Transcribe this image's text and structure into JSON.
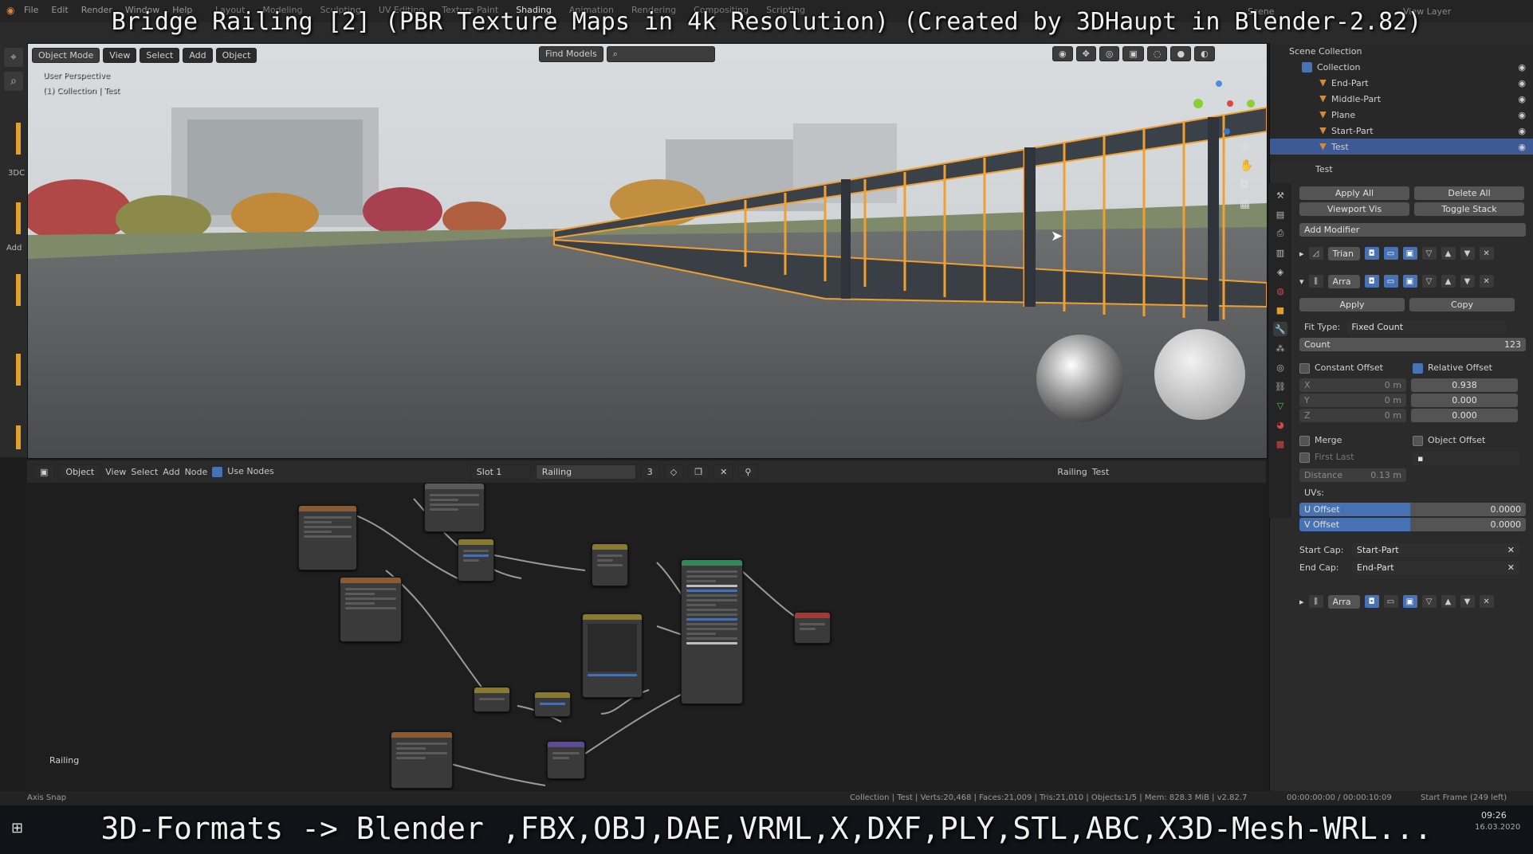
{
  "overlay": {
    "title": "Bridge Railing [2] (PBR Texture Maps in 4k Resolution) (Created by 3DHaupt in Blender-2.82)",
    "bottom": "3D-Formats -> Blender ,FBX,OBJ,DAE,VRML,X,DXF,PLY,STL,ABC,X3D-Mesh-WRL..."
  },
  "topbar": {
    "menus": [
      "File",
      "Edit",
      "Render",
      "Window",
      "Help"
    ],
    "workspaces": [
      "Layout",
      "Modeling",
      "Sculpting",
      "UV Editing",
      "Texture Paint",
      "Shading",
      "Animation",
      "Rendering",
      "Compositing",
      "Scripting"
    ],
    "active_workspace": "Shading",
    "scene": "Scene",
    "view_layer": "View Layer"
  },
  "viewport": {
    "mode": "Object Mode",
    "menus": [
      "View",
      "Select",
      "Add",
      "Object"
    ],
    "find_models": "Find Models",
    "perspective_label": "User Perspective",
    "collection_label": "(1) Collection | Test"
  },
  "left_strip": {
    "label_3d": "3DC",
    "label_add": "Add"
  },
  "node_editor": {
    "type": "Object",
    "menus": [
      "View",
      "Select",
      "Add",
      "Node"
    ],
    "use_nodes": "Use Nodes",
    "slot": "Slot 1",
    "material": "Railing",
    "users": "3",
    "material_right": "Railing",
    "object_right": "Test",
    "frame_label": "Railing"
  },
  "outliner": {
    "root": "Scene Collection",
    "collection": "Collection",
    "items": [
      "End-Part",
      "Middle-Part",
      "Plane",
      "Start-Part",
      "Test"
    ],
    "selected": "Test"
  },
  "properties": {
    "object_name": "Test",
    "apply_all": "Apply All",
    "delete_all": "Delete All",
    "viewport_vis": "Viewport Vis",
    "toggle_stack": "Toggle Stack",
    "add_modifier": "Add Modifier",
    "modifier1": "Trian",
    "modifier2": "Arra",
    "apply": "Apply",
    "copy": "Copy",
    "fit_type_label": "Fit Type:",
    "fit_type": "Fixed Count",
    "count_label": "Count",
    "count": "123",
    "constant_offset": "Constant Offset",
    "relative_offset": "Relative Offset",
    "x_label": "X",
    "y_label": "Y",
    "z_label": "Z",
    "const_x": "0 m",
    "const_y": "0 m",
    "const_z": "0 m",
    "rel_x": "0.938",
    "rel_y": "0.000",
    "rel_z": "0.000",
    "merge": "Merge",
    "object_offset": "Object Offset",
    "first_last": "First Last",
    "distance_label": "Distance",
    "distance": "0.13 m",
    "uvs": "UVs:",
    "u_offset_label": "U Offset",
    "u_offset": "0.0000",
    "v_offset_label": "V Offset",
    "v_offset": "0.0000",
    "start_cap_label": "Start Cap:",
    "start_cap": "Start-Part",
    "end_cap_label": "End Cap:",
    "end_cap": "End-Part",
    "modifier3": "Arra"
  },
  "statusbar": {
    "left": "Axis Snap",
    "stats": "Collection | Test | Verts:20,468 | Faces:21,009 | Tris:21,010 | Objects:1/5 | Mem: 828.3 MiB | v2.82.7",
    "time": "00:00:00:00 / 00:00:10:09",
    "frame": "Start Frame (249 left)"
  },
  "taskbar": {
    "clock": "09:26",
    "date": "16.03.2020"
  },
  "colors": {
    "selection": "#4772b3",
    "outline_orange": "#f0a030",
    "outliner_select": "#3c5b96"
  }
}
